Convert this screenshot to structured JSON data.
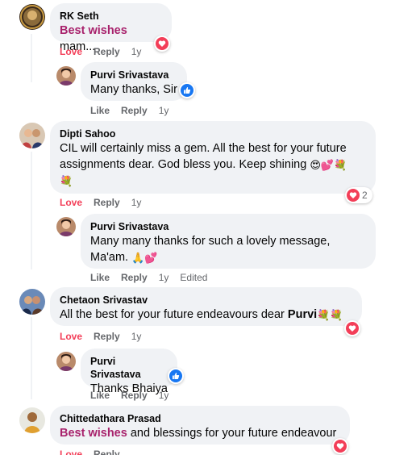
{
  "comments": [
    {
      "author": "RK Seth",
      "highlight": "Best wishes",
      "text_rest": " mam...",
      "actions": {
        "react": "Love",
        "reply": "Reply",
        "age": "1y"
      },
      "reaction_icon": "heart-icon"
    },
    {
      "author": "Purvi Srivastava",
      "text": "Many thanks, Sir",
      "actions": {
        "react": "Like",
        "reply": "Reply",
        "age": "1y"
      },
      "reaction_icon": "like-icon"
    },
    {
      "author": "Dipti Sahoo",
      "text_line1": "CIL will certainly miss a gem. All the best for your future",
      "text_line2": "assignments dear. God bless you. Keep shining",
      "emoji_line2": "😍💕💐",
      "emoji_line3": "💐",
      "actions": {
        "react": "Love",
        "reply": "Reply",
        "age": "1y"
      },
      "reaction_icon": "heart-icon",
      "reaction_count": "2"
    },
    {
      "author": "Purvi Srivastava",
      "text_line1": "Many many thanks for such a lovely message,",
      "text_line2": "Ma'am.",
      "emoji_line2": "🙏💕",
      "actions": {
        "react": "Like",
        "reply": "Reply",
        "age": "1y",
        "edited": "Edited"
      }
    },
    {
      "author": "Chetaon Srivastav",
      "text": "All the best for your future endeavours dear ",
      "mention": "Purvi",
      "emoji": "💐💐",
      "actions": {
        "react": "Love",
        "reply": "Reply",
        "age": "1y"
      },
      "reaction_icon": "heart-icon"
    },
    {
      "author": "Purvi Srivastava",
      "text": "Thanks Bhaiya",
      "actions": {
        "react": "Like",
        "reply": "Reply",
        "age": "1y"
      },
      "reaction_icon": "like-icon"
    },
    {
      "author": "Chittedathara Prasad",
      "highlight": "Best wishes",
      "text_rest": " and blessings for your future endeavour",
      "actions": {
        "react": "Love",
        "reply": "Reply"
      },
      "reaction_icon": "heart-icon"
    }
  ],
  "colors": {
    "bubble": "#f0f2f5",
    "love": "#f33e58",
    "like": "#1877f2",
    "highlight": "#a8226c",
    "meta": "#65676b"
  }
}
